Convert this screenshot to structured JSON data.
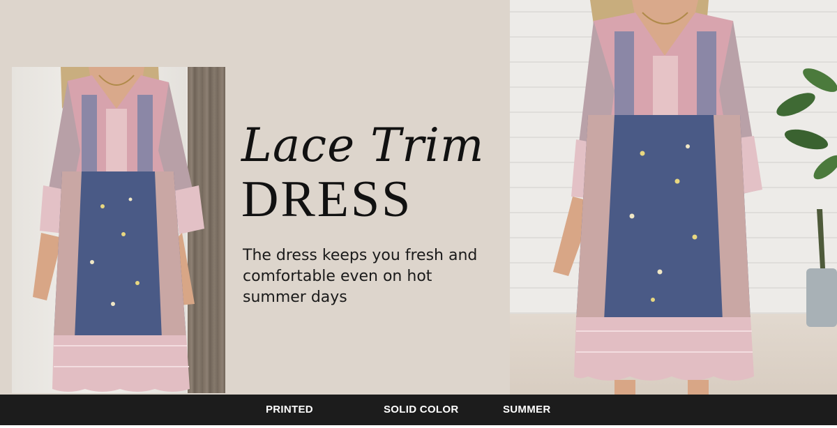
{
  "banner": {
    "headline_script": "Lace Trim",
    "headline_main": "DRESS",
    "description": "The dress keeps you fresh and comfortable even on hot summer days"
  },
  "tags": [
    {
      "label": "PRINTED"
    },
    {
      "label": "SOLID COLOR"
    },
    {
      "label": "SUMMER"
    }
  ],
  "colors": {
    "background": "#ddd5cc",
    "tag_bar": "#1c1c1c",
    "dress_navy": "#4a5a86",
    "dress_pink": "#d9a9b2",
    "lace": "#e9c9cd"
  }
}
